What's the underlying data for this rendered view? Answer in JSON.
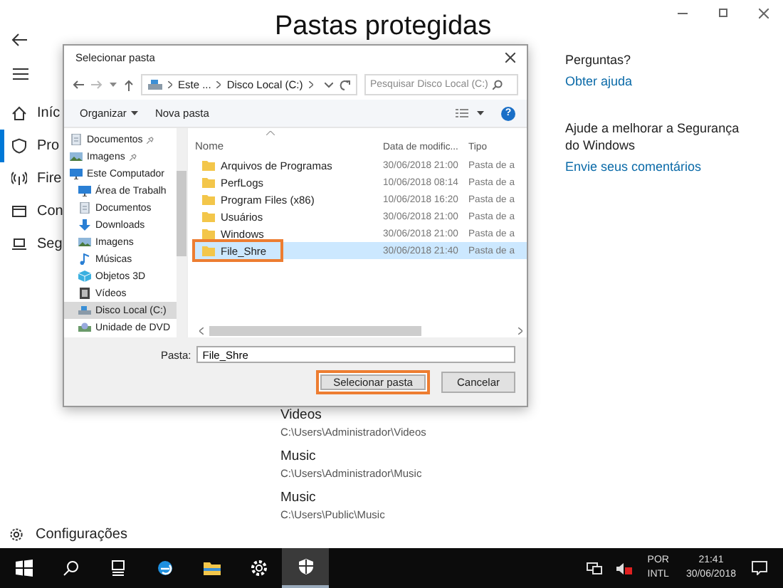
{
  "window": {
    "title": "Pastas protegidas"
  },
  "sidebar": {
    "items": [
      {
        "label": "Iníc",
        "kind": "home",
        "selected": false
      },
      {
        "label": "Pro",
        "kind": "shield",
        "selected": true
      },
      {
        "label": "Fire",
        "kind": "wifi",
        "selected": false
      },
      {
        "label": "Con",
        "kind": "app",
        "selected": false
      },
      {
        "label": "Seg",
        "kind": "laptop",
        "selected": false
      }
    ],
    "settings": "Configurações"
  },
  "folders": [
    {
      "name": "Videos",
      "path": "C:\\Users\\Administrador\\Videos"
    },
    {
      "name": "Music",
      "path": "C:\\Users\\Administrador\\Music"
    },
    {
      "name": "Music",
      "path": "C:\\Users\\Public\\Music"
    }
  ],
  "help": {
    "heading": "Perguntas?",
    "link": "Obter ajuda",
    "improve": "Ajude a melhorar a Segurança do Windows",
    "feedback": "Envie seus comentários"
  },
  "dialog": {
    "title": "Selecionar pasta",
    "breadcrumb": [
      "Este ...",
      "Disco Local (C:)"
    ],
    "search": {
      "placeholder": "Pesquisar Disco Local (C:)"
    },
    "toolbar": {
      "organize": "Organizar",
      "new_folder": "Nova pasta",
      "help": "?"
    },
    "nav": [
      {
        "label": "Documentos",
        "kind": "documents",
        "pinned": true,
        "selected": false
      },
      {
        "label": "Imagens",
        "kind": "pictures",
        "pinned": true,
        "selected": false
      },
      {
        "label": "Este Computador",
        "kind": "computer",
        "pinned": false,
        "selected": false
      },
      {
        "label": "Área de Trabalh",
        "kind": "desktop",
        "pinned": false,
        "selected": false
      },
      {
        "label": "Documentos",
        "kind": "documents",
        "pinned": false,
        "selected": false
      },
      {
        "label": "Downloads",
        "kind": "downloads",
        "pinned": false,
        "selected": false
      },
      {
        "label": "Imagens",
        "kind": "pictures",
        "pinned": false,
        "selected": false
      },
      {
        "label": "Músicas",
        "kind": "music",
        "pinned": false,
        "selected": false
      },
      {
        "label": "Objetos 3D",
        "kind": "objects",
        "pinned": false,
        "selected": false
      },
      {
        "label": "Vídeos",
        "kind": "videos",
        "pinned": false,
        "selected": false
      },
      {
        "label": "Disco Local (C:)",
        "kind": "drive",
        "pinned": false,
        "selected": true
      },
      {
        "label": "Unidade de DVD",
        "kind": "dvd",
        "pinned": false,
        "selected": false
      }
    ],
    "columns": [
      "Nome",
      "Data de modific...",
      "Tipo"
    ],
    "rows": [
      {
        "name": "Arquivos de Programas",
        "date": "30/06/2018 21:00",
        "type": "Pasta de a",
        "selected": false,
        "highlighted": false
      },
      {
        "name": "PerfLogs",
        "date": "10/06/2018 08:14",
        "type": "Pasta de a",
        "selected": false,
        "highlighted": false
      },
      {
        "name": "Program Files (x86)",
        "date": "10/06/2018 16:20",
        "type": "Pasta de a",
        "selected": false,
        "highlighted": false
      },
      {
        "name": "Usuários",
        "date": "30/06/2018 21:00",
        "type": "Pasta de a",
        "selected": false,
        "highlighted": false
      },
      {
        "name": "Windows",
        "date": "30/06/2018 21:00",
        "type": "Pasta de a",
        "selected": false,
        "highlighted": false
      },
      {
        "name": "File_Shre",
        "date": "30/06/2018 21:40",
        "type": "Pasta de a",
        "selected": true,
        "highlighted": true
      }
    ],
    "folder_field": {
      "label": "Pasta:",
      "value": "File_Shre"
    },
    "buttons": [
      {
        "label": "Selecionar pasta",
        "highlighted": true
      },
      {
        "label": "Cancelar",
        "highlighted": false
      }
    ]
  },
  "taskbar": {
    "apps": [
      {
        "kind": "start",
        "active": false
      },
      {
        "kind": "search",
        "active": false
      },
      {
        "kind": "taskview",
        "active": false
      },
      {
        "kind": "browser",
        "active": false
      },
      {
        "kind": "explorer",
        "active": false
      },
      {
        "kind": "settings",
        "active": false
      },
      {
        "kind": "shield",
        "active": true
      }
    ],
    "language": [
      "POR",
      "INTL"
    ],
    "time": "21:41",
    "date": "30/06/2018"
  }
}
